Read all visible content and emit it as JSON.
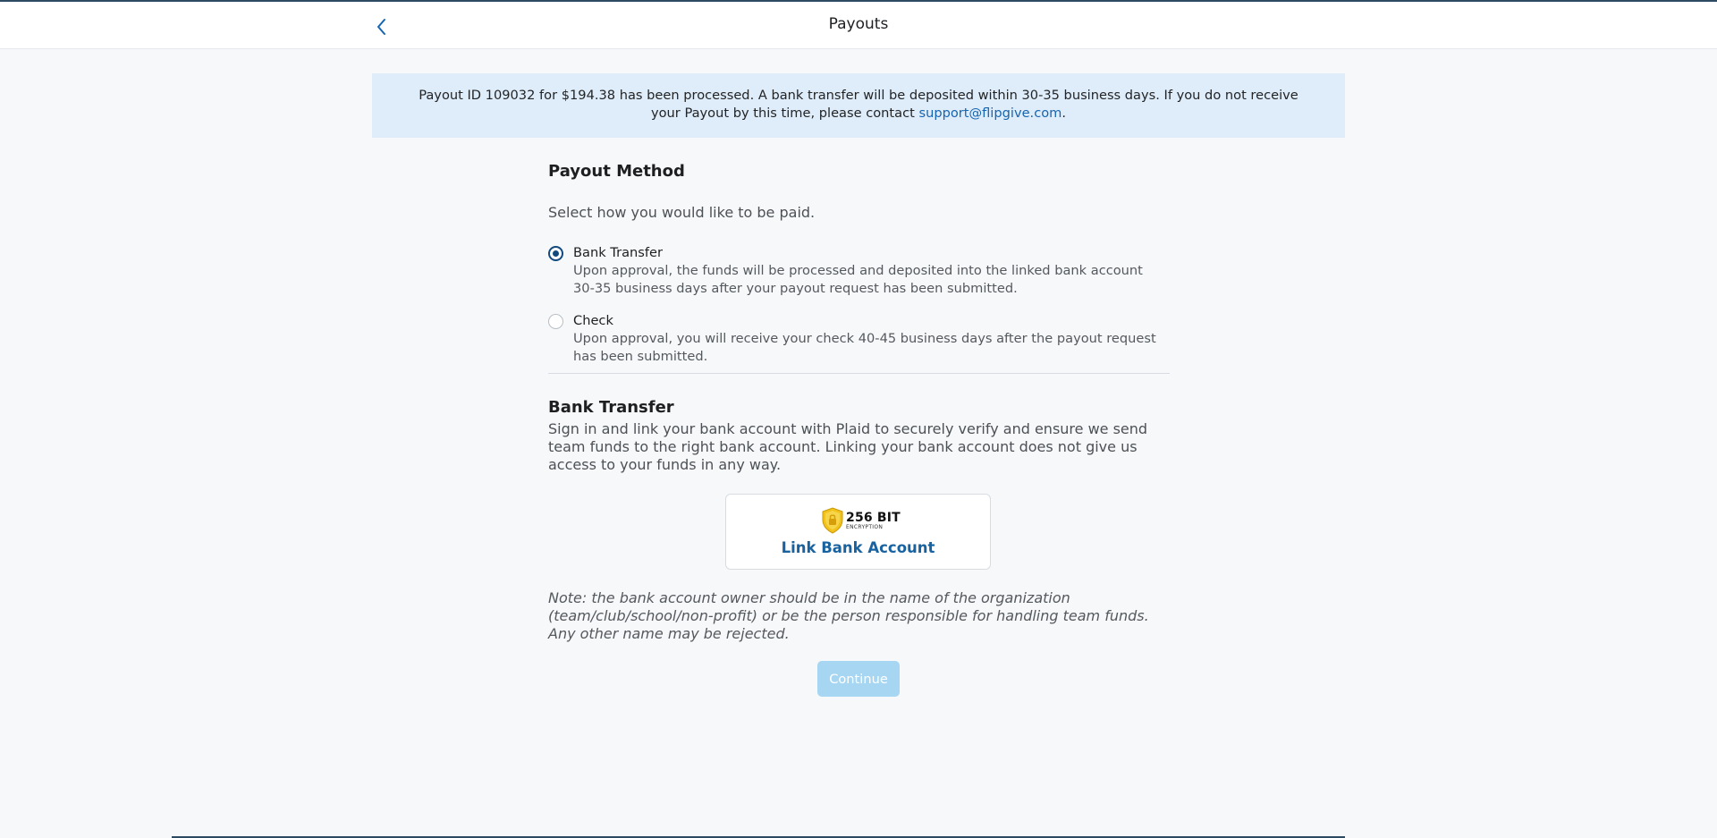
{
  "header": {
    "title": "Payouts",
    "back_icon": "chevron-left-icon"
  },
  "banner": {
    "message": "Payout ID 109032 for $194.38 has been processed. A bank transfer will be deposited within 30-35 business days. If you do not receive your Payout by this time, please contact ",
    "email": "support@flipgive.com",
    "suffix": "."
  },
  "payout_method": {
    "heading": "Payout Method",
    "instruction": "Select how you would like to be paid.",
    "options": [
      {
        "label": "Bank Transfer",
        "description": "Upon approval, the funds will be processed and deposited into the linked bank account 30-35 business days after your payout request has been submitted.",
        "selected": true
      },
      {
        "label": "Check",
        "description": "Upon approval, you will receive your check 40-45 business days after the payout request has been submitted.",
        "selected": false
      }
    ]
  },
  "bank_transfer": {
    "heading": "Bank Transfer",
    "description": "Sign in and link your bank account with Plaid to securely verify and ensure we send team funds to the right bank account. Linking your bank account does not give us access to your funds in any way.",
    "badge": {
      "bits": "256 BIT",
      "caption": "ENCRYPTION",
      "icon": "shield-icon"
    },
    "link_button_label": "Link Bank Account",
    "note": "Note: the bank account owner should be in the name of the organization (team/club/school/non-profit) or be the person responsible for handling team funds. Any other name may be rejected."
  },
  "continue_label": "Continue",
  "colors": {
    "accent": "#124a7f",
    "link": "#1565b0",
    "banner_bg": "#dfecfa",
    "continue_disabled": "#a7d6f2"
  }
}
